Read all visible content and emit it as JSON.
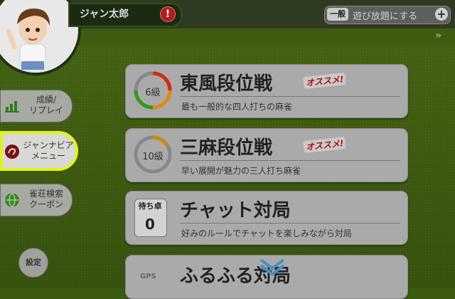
{
  "header": {
    "player_name": "ジャン太郎",
    "alert_symbol": "!",
    "play_badge": "一般",
    "play_label": "遊び放題にする",
    "play_plus": "+",
    "more_chevrons": "»"
  },
  "sidebar": {
    "items": [
      {
        "label1": "成績/",
        "label2": "リプレイ",
        "icon": "bar-chart-icon"
      },
      {
        "label1": "ジャンナビア",
        "label2": "メニュー",
        "icon": "janavia-logo-icon"
      },
      {
        "label1": "雀荘検索",
        "label2": "クーポン",
        "icon": "globe-icon"
      }
    ],
    "settings_label": "設定"
  },
  "cards": [
    {
      "title": "東風段位戦",
      "desc": "最も一般的な四人打ちの麻雀",
      "rank": "6級",
      "badge": "オススメ!"
    },
    {
      "title": "三麻段位戦",
      "desc": "早い展開が魅力の三人打ち麻雀",
      "rank": "10級",
      "badge": "オススメ!"
    },
    {
      "title": "チャット対局",
      "desc": "好みのルールでチャットを楽しみながら対局",
      "wait_label": "待ち卓",
      "wait_count": "0"
    },
    {
      "title": "ふるふる対局",
      "gps": "GPS"
    }
  ],
  "colors": {
    "highlight": "#e5f11c",
    "alert": "#b01c1c",
    "accent_badge": "#b60e0e"
  }
}
